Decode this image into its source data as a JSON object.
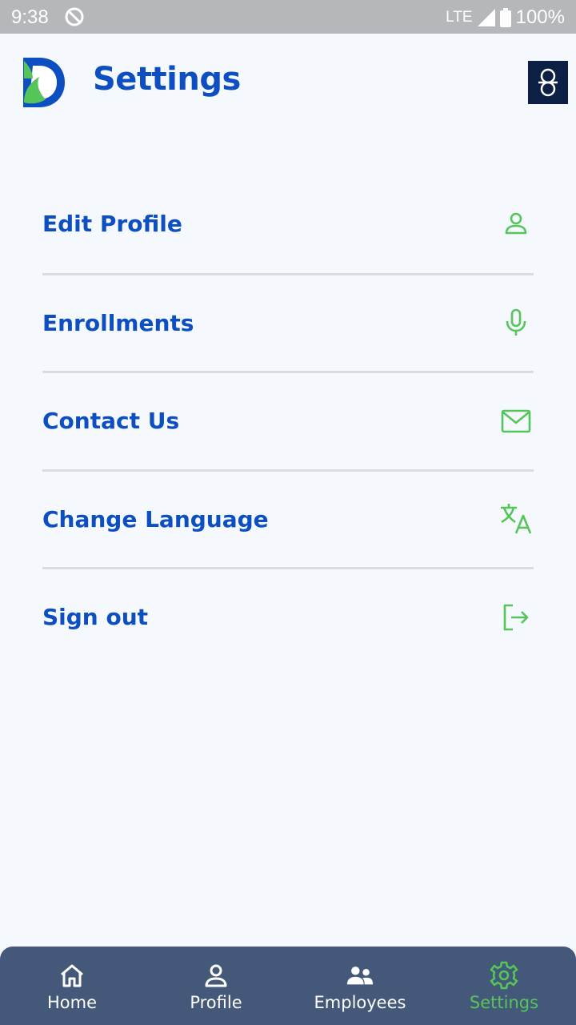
{
  "status_bar": {
    "time": "9:38",
    "network": "LTE",
    "battery": "100%"
  },
  "header": {
    "title": "Settings"
  },
  "menu": {
    "items": [
      {
        "label": "Edit Profile",
        "icon": "person-outline-icon"
      },
      {
        "label": "Enrollments",
        "icon": "microphone-icon"
      },
      {
        "label": "Contact Us",
        "icon": "mail-icon"
      },
      {
        "label": "Change Language",
        "icon": "translate-icon"
      },
      {
        "label": "Sign out",
        "icon": "logout-icon"
      }
    ]
  },
  "bottom_nav": {
    "items": [
      {
        "label": "Home",
        "icon": "home-icon",
        "active": false
      },
      {
        "label": "Profile",
        "icon": "person-icon",
        "active": false
      },
      {
        "label": "Employees",
        "icon": "people-icon",
        "active": false
      },
      {
        "label": "Settings",
        "icon": "gear-icon",
        "active": true
      }
    ]
  },
  "colors": {
    "primary": "#0d4fc1",
    "accent": "#55c55a",
    "nav_background": "#44597a",
    "page_background": "#f5f8fd"
  }
}
